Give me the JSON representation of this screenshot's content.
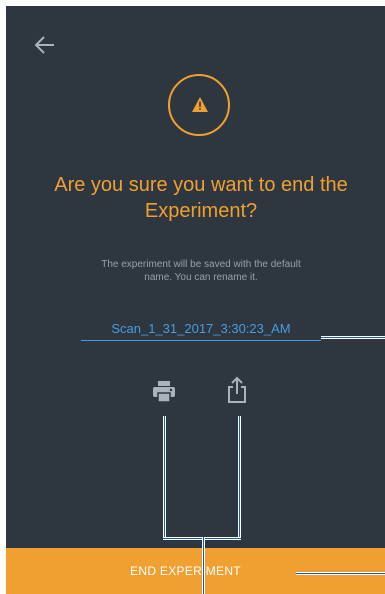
{
  "header": {
    "back_icon": "arrow-left-icon"
  },
  "dialog": {
    "warning_icon": "warning-icon",
    "title": "Are you sure you want to end the Experiment?",
    "subtitle": "The experiment will be saved with the default name. You can rename it.",
    "experiment_name": "Scan_1_31_2017_3:30:23_AM"
  },
  "actions": {
    "print_icon": "printer-icon",
    "share_icon": "share-icon",
    "end_label": "END EXPERIMENT"
  },
  "colors": {
    "background": "#2e363f",
    "accent": "#f0a030",
    "link": "#4a9be0",
    "muted_text": "#97a1ab",
    "callout": "#1f5fb0"
  }
}
